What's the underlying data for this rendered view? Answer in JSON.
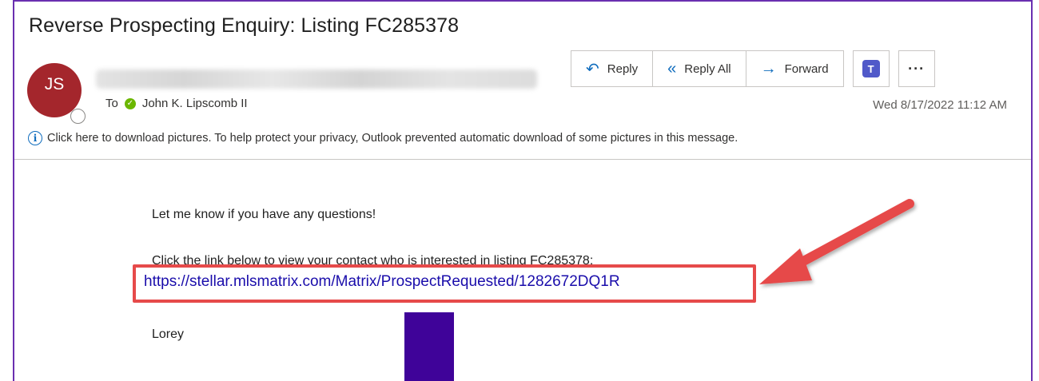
{
  "email": {
    "subject": "Reverse Prospecting Enquiry: Listing FC285378",
    "avatar_initials": "JS",
    "to_label": "To",
    "recipient": "John K. Lipscomb II",
    "date": "Wed 8/17/2022 11:12 AM",
    "info_message": "Click here to download pictures. To help protect your privacy, Outlook prevented automatic download of some pictures in this message."
  },
  "toolbar": {
    "reply_label": "Reply",
    "reply_all_label": "Reply All",
    "forward_label": "Forward",
    "more_label": "···"
  },
  "body": {
    "line1": "Let me know if you have any questions!",
    "line2": "Click the link below to view your contact who is interested in listing FC285378:",
    "link": "https://stellar.mlsmatrix.com/Matrix/ProspectRequested/1282672DQ1R",
    "signature": "Lorey"
  },
  "colors": {
    "avatar": "#a4262c",
    "highlight": "#e64a4a",
    "accent": "#0f6cbd",
    "frame": "#6a2fb0"
  }
}
